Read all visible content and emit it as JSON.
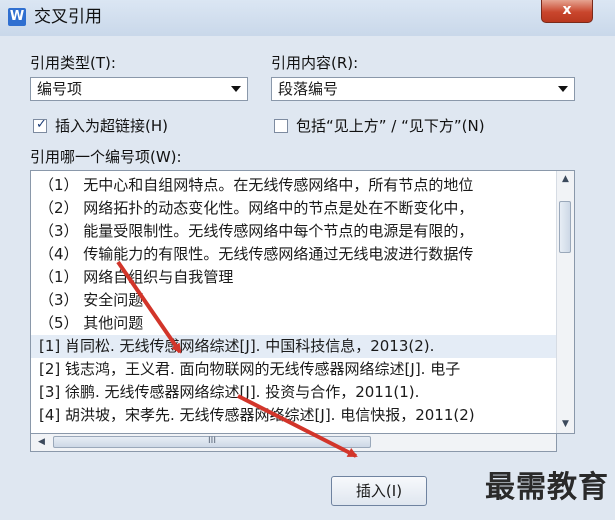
{
  "window": {
    "title": "交叉引用",
    "close_glyph": "x"
  },
  "ref_type": {
    "label": "引用类型(T):",
    "value": "编号项"
  },
  "ref_content": {
    "label": "引用内容(R):",
    "value": "段落编号"
  },
  "insert_hyperlink": {
    "label": "插入为超链接(H)",
    "checked": true
  },
  "include_above_below": {
    "label": "包括“见上方” / “见下方”(N)",
    "checked": false
  },
  "list_label": "引用哪一个编号项(W):",
  "items": [
    "（1） 无中心和自组网特点。在无线传感网络中，所有节点的地位",
    "（2） 网络拓扑的动态变化性。网络中的节点是处在不断变化中，",
    "（3） 能量受限制性。无线传感网络中每个节点的电源是有限的，",
    "（4） 传输能力的有限性。无线传感网络通过无线电波进行数据传",
    "（1） 网络自组织与自我管理",
    "（3） 安全问题",
    "（5） 其他问题",
    "[1] 肖同松. 无线传感网络综述[J]. 中国科技信息，2013(2).",
    "[2] 钱志鸿，王义君. 面向物联网的无线传感器网络综述[J]. 电子",
    "[3] 徐鹏. 无线传感器网络综述[J]. 投资与合作，2011(1).",
    "[4] 胡洪坡，宋孝先. 无线传感器网络综述[J]. 电信快报，2011(2)"
  ],
  "selected_index": 7,
  "scroll": {
    "up": "▲",
    "down": "▼",
    "left": "◀",
    "thumb_grip": "III"
  },
  "insert_button": "插入(I)",
  "watermark": "最需教育",
  "colors": {
    "annotation_arrow": "#d2352a",
    "selection": "#e4ecf6"
  }
}
